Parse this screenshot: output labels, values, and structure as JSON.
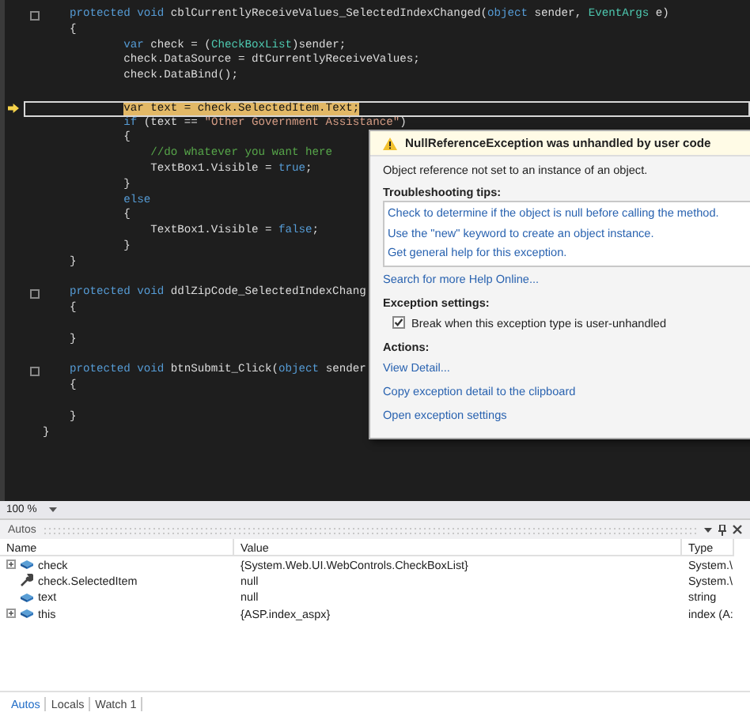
{
  "editor": {
    "lines": [
      {
        "kind": "code",
        "collapse": true,
        "segments": [
          {
            "kind": "kw",
            "text": "    protected void "
          },
          {
            "kind": "plain",
            "text": "cblCurrentlyReceiveValues_SelectedIndexChanged("
          },
          {
            "kind": "kw",
            "text": "object"
          },
          {
            "kind": "plain",
            "text": " sender, "
          },
          {
            "kind": "type",
            "text": "EventArgs"
          },
          {
            "kind": "plain",
            "text": " e)"
          }
        ]
      },
      {
        "kind": "code",
        "segments": [
          {
            "kind": "plain",
            "text": "    {"
          }
        ]
      },
      {
        "kind": "code",
        "segments": [
          {
            "kind": "kw",
            "text": "            var"
          },
          {
            "kind": "plain",
            "text": " check = ("
          },
          {
            "kind": "type",
            "text": "CheckBoxList"
          },
          {
            "kind": "plain",
            "text": ")sender;"
          }
        ]
      },
      {
        "kind": "code",
        "segments": [
          {
            "kind": "plain",
            "text": "            check.DataSource = dtCurrentlyReceiveValues;"
          }
        ]
      },
      {
        "kind": "code",
        "segments": [
          {
            "kind": "plain",
            "text": "            check.DataBind();"
          }
        ]
      },
      {
        "kind": "blank"
      },
      {
        "kind": "code",
        "current": true,
        "segments": [
          {
            "kind": "kw",
            "text": "            var"
          },
          {
            "kind": "plain",
            "text": " text = check.SelectedItem.Text;"
          }
        ]
      },
      {
        "kind": "code",
        "segments": [
          {
            "kind": "kw",
            "text": "            if"
          },
          {
            "kind": "plain",
            "text": " (text == "
          },
          {
            "kind": "str",
            "text": "\"Other Government Assistance\""
          },
          {
            "kind": "plain",
            "text": ")"
          }
        ]
      },
      {
        "kind": "code",
        "segments": [
          {
            "kind": "plain",
            "text": "            {"
          }
        ]
      },
      {
        "kind": "code",
        "segments": [
          {
            "kind": "comment",
            "text": "                //do whatever you want here"
          }
        ]
      },
      {
        "kind": "code",
        "segments": [
          {
            "kind": "plain",
            "text": "                TextBox1.Visible = "
          },
          {
            "kind": "kw",
            "text": "true"
          },
          {
            "kind": "plain",
            "text": ";"
          }
        ]
      },
      {
        "kind": "code",
        "segments": [
          {
            "kind": "plain",
            "text": "            }"
          }
        ]
      },
      {
        "kind": "code",
        "segments": [
          {
            "kind": "kw",
            "text": "            else"
          }
        ]
      },
      {
        "kind": "code",
        "segments": [
          {
            "kind": "plain",
            "text": "            {"
          }
        ]
      },
      {
        "kind": "code",
        "segments": [
          {
            "kind": "plain",
            "text": "                TextBox1.Visible = "
          },
          {
            "kind": "kw",
            "text": "false"
          },
          {
            "kind": "plain",
            "text": ";"
          }
        ]
      },
      {
        "kind": "code",
        "segments": [
          {
            "kind": "plain",
            "text": "            }"
          }
        ]
      },
      {
        "kind": "code",
        "segments": [
          {
            "kind": "plain",
            "text": "    }"
          }
        ]
      },
      {
        "kind": "blank"
      },
      {
        "kind": "code",
        "collapse": true,
        "segments": [
          {
            "kind": "kw",
            "text": "    protected void "
          },
          {
            "kind": "plain",
            "text": "ddlZipCode_SelectedIndexChang"
          }
        ]
      },
      {
        "kind": "code",
        "segments": [
          {
            "kind": "plain",
            "text": "    {"
          }
        ]
      },
      {
        "kind": "blank"
      },
      {
        "kind": "code",
        "segments": [
          {
            "kind": "plain",
            "text": "    }"
          }
        ]
      },
      {
        "kind": "blank"
      },
      {
        "kind": "code",
        "collapse": true,
        "segments": [
          {
            "kind": "kw",
            "text": "    protected void "
          },
          {
            "kind": "plain",
            "text": "btnSubmit_Click("
          },
          {
            "kind": "kw",
            "text": "object"
          },
          {
            "kind": "plain",
            "text": " sender"
          }
        ]
      },
      {
        "kind": "code",
        "segments": [
          {
            "kind": "plain",
            "text": "    {"
          }
        ]
      },
      {
        "kind": "blank"
      },
      {
        "kind": "code",
        "segments": [
          {
            "kind": "plain",
            "text": "    }"
          }
        ]
      },
      {
        "kind": "code",
        "segments": [
          {
            "kind": "plain",
            "text": "}"
          }
        ]
      }
    ],
    "zoom": "100 %"
  },
  "exception_popup": {
    "title": "NullReferenceException was unhandled by user code",
    "message": "Object reference not set to an instance of an object.",
    "tips_heading": "Troubleshooting tips:",
    "tips": [
      "Check to determine if the object is null before calling the method.",
      "Use the \"new\" keyword to create an object instance.",
      "Get general help for this exception."
    ],
    "search_link": "Search for more Help Online...",
    "settings_heading": "Exception settings:",
    "break_option": {
      "label": "Break when this exception type is user-unhandled",
      "checked": true
    },
    "actions_heading": "Actions:",
    "actions": [
      "View Detail...",
      "Copy exception detail to the clipboard",
      "Open exception settings"
    ]
  },
  "autos": {
    "title": "Autos",
    "columns": [
      "Name",
      "Value",
      "Type"
    ],
    "rows": [
      {
        "kind": "field",
        "name": "check",
        "value": "{System.Web.UI.WebControls.CheckBoxList}",
        "type": "System.\\",
        "expandable": true
      },
      {
        "kind": "property",
        "name": "check.SelectedItem",
        "value": "null",
        "type": "System.\\",
        "expandable": false
      },
      {
        "kind": "field",
        "name": "text",
        "value": "null",
        "type": "string",
        "expandable": false
      },
      {
        "kind": "field",
        "name": "this",
        "value": "{ASP.index_aspx}",
        "type": "index (A:",
        "expandable": true
      }
    ],
    "tabs": [
      {
        "label": "Autos",
        "selected": true
      },
      {
        "label": "Locals",
        "selected": false
      },
      {
        "label": "Watch 1",
        "selected": false
      }
    ]
  }
}
